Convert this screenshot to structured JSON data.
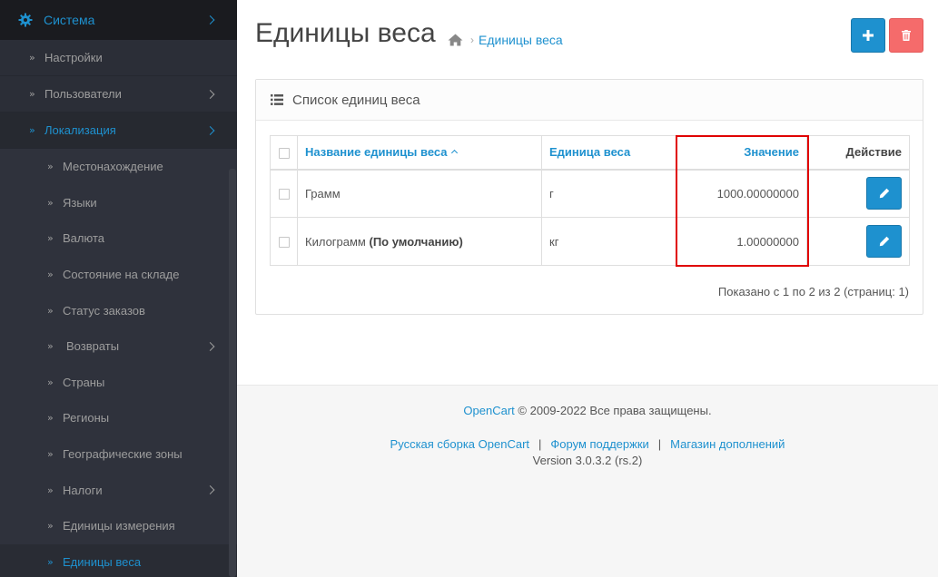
{
  "sidebar": {
    "top": {
      "label": "Система",
      "icon": "gear-icon"
    },
    "items": [
      {
        "label": "Настройки"
      },
      {
        "label": "Пользователи"
      },
      {
        "label": "Локализация"
      }
    ],
    "sub_items": [
      {
        "label": "Местонахождение"
      },
      {
        "label": "Языки"
      },
      {
        "label": "Валюта"
      },
      {
        "label": "Состояние на складе"
      },
      {
        "label": "Статус заказов"
      },
      {
        "label": "Возвраты"
      },
      {
        "label": "Страны"
      },
      {
        "label": "Регионы"
      },
      {
        "label": "Географические зоны"
      },
      {
        "label": "Налоги"
      },
      {
        "label": "Единицы измерения"
      },
      {
        "label": "Единицы веса"
      }
    ]
  },
  "header": {
    "title": "Единицы веса",
    "breadcrumb": "Единицы веса"
  },
  "panel": {
    "title": "Список единиц веса",
    "columns": {
      "name": "Название единицы веса",
      "unit": "Единица веса",
      "value": "Значение",
      "action": "Действие"
    },
    "rows": [
      {
        "name": "Грамм",
        "default_suffix": "",
        "unit": "г",
        "value": "1000.00000000"
      },
      {
        "name": "Килограмм",
        "default_suffix": "(По умолчанию)",
        "unit": "кг",
        "value": "1.00000000"
      }
    ],
    "pagination_text": "Показано с 1 по 2 из 2 (страниц: 1)"
  },
  "footer": {
    "brand": "OpenCart",
    "copyright": "© 2009-2022 Все права защищены.",
    "links": [
      "Русская сборка OpenCart",
      "Форум поддержки",
      "Магазин дополнений"
    ],
    "version": "Version 3.0.3.2 (rs.2)"
  },
  "colors": {
    "accent": "#1e91cf",
    "danger": "#f56b6b",
    "highlight": "#e00000",
    "sidebar_bg": "#2b2e37"
  }
}
